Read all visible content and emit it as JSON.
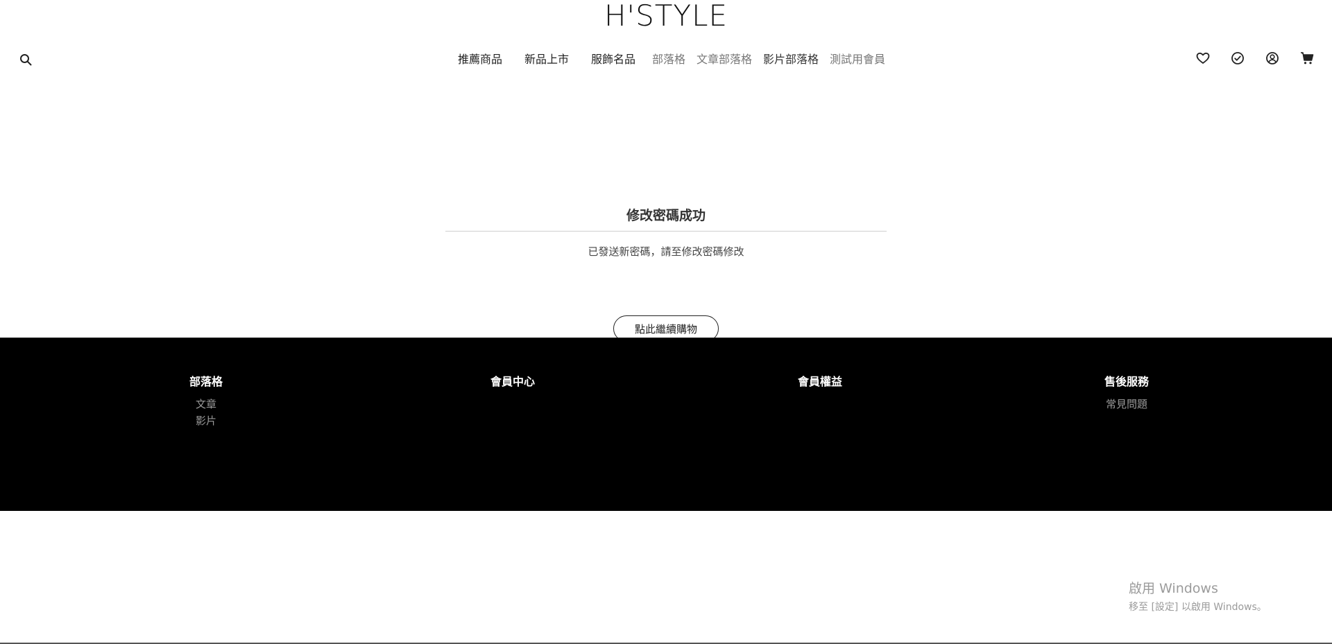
{
  "header": {
    "brand": "H'STYLE",
    "nav": [
      {
        "label": "推薦商品",
        "style": "strong"
      },
      {
        "label": "新品上市",
        "style": "strong"
      },
      {
        "label": "服飾名品",
        "style": "strong"
      },
      {
        "label": "部落格",
        "style": "muted"
      },
      {
        "label": "文章部落格",
        "style": "muted"
      },
      {
        "label": "影片部落格",
        "style": "strong"
      },
      {
        "label": "測試用會員",
        "style": "muted"
      }
    ],
    "icons": [
      "search-icon",
      "heart-icon",
      "check-circle-icon",
      "user-circle-icon",
      "cart-icon"
    ]
  },
  "main": {
    "title": "修改密碼成功",
    "body": "已發送新密碼，請至修改密碼修改",
    "continue_button": "點此繼續購物"
  },
  "footer": {
    "columns": [
      {
        "title": "部落格",
        "links": [
          "文章",
          "影片"
        ]
      },
      {
        "title": "會員中心",
        "links": []
      },
      {
        "title": "會員權益",
        "links": []
      },
      {
        "title": "售後服務",
        "links": [
          "常見問題"
        ]
      }
    ]
  },
  "watermark": {
    "line1": "啟用 Windows",
    "line2": "移至 [設定] 以啟用 Windows。"
  },
  "colors": {
    "footer_bg": "#000000",
    "text": "#222222",
    "muted": "#777777"
  }
}
